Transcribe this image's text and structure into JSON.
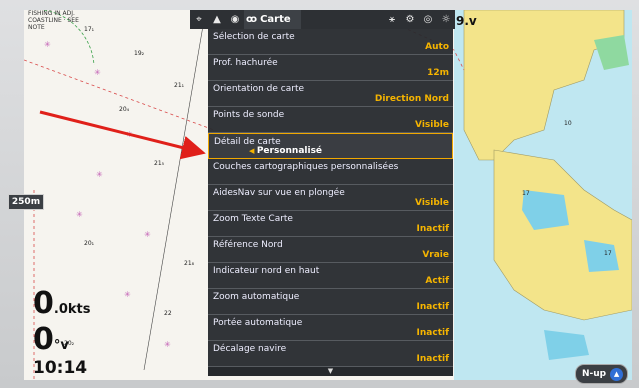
{
  "topbar": {
    "title": "Carte",
    "icons": [
      "crosshair-icon",
      "bell-icon",
      "compass-icon",
      "chart-icon",
      "satellite-icon",
      "gear-icon",
      "eye-icon",
      "sun-icon"
    ]
  },
  "menu": {
    "items": [
      {
        "label": "Sélection de carte",
        "value": "Auto"
      },
      {
        "label": "Prof. hachurée",
        "value": "12m"
      },
      {
        "label": "Orientation de carte",
        "value": "Direction Nord"
      },
      {
        "label": "Points de sonde",
        "value": "Visible"
      },
      {
        "label": "Détail de carte",
        "value": "Personnalisé"
      },
      {
        "label": "Couches cartographiques personnalisées",
        "value": ""
      },
      {
        "label": "AidesNav sur vue en plongée",
        "value": "Visible"
      },
      {
        "label": "Zoom Texte Carte",
        "value": "Inactif"
      },
      {
        "label": "Référence Nord",
        "value": "Vraie"
      },
      {
        "label": "Indicateur nord en haut",
        "value": "Actif"
      },
      {
        "label": "Zoom automatique",
        "value": "Inactif"
      },
      {
        "label": "Portée automatique",
        "value": "Inactif"
      },
      {
        "label": "Décalage navire",
        "value": "Inactif"
      }
    ]
  },
  "overlay": {
    "scale": "250m",
    "speed_value": "0",
    "speed_unit": ".0kts",
    "heading_value": "0",
    "heading_unit": "°v",
    "time": "10:14",
    "depth_suffix": "9.v",
    "nup_label": "N-up"
  },
  "colors": {
    "menu_bg": "#26292d",
    "accent": "#f5b400",
    "selection_border": "#f0a800",
    "land": "#f3e48a",
    "shallow_water": "#7fd0e8",
    "pointer": "#e0201a"
  }
}
